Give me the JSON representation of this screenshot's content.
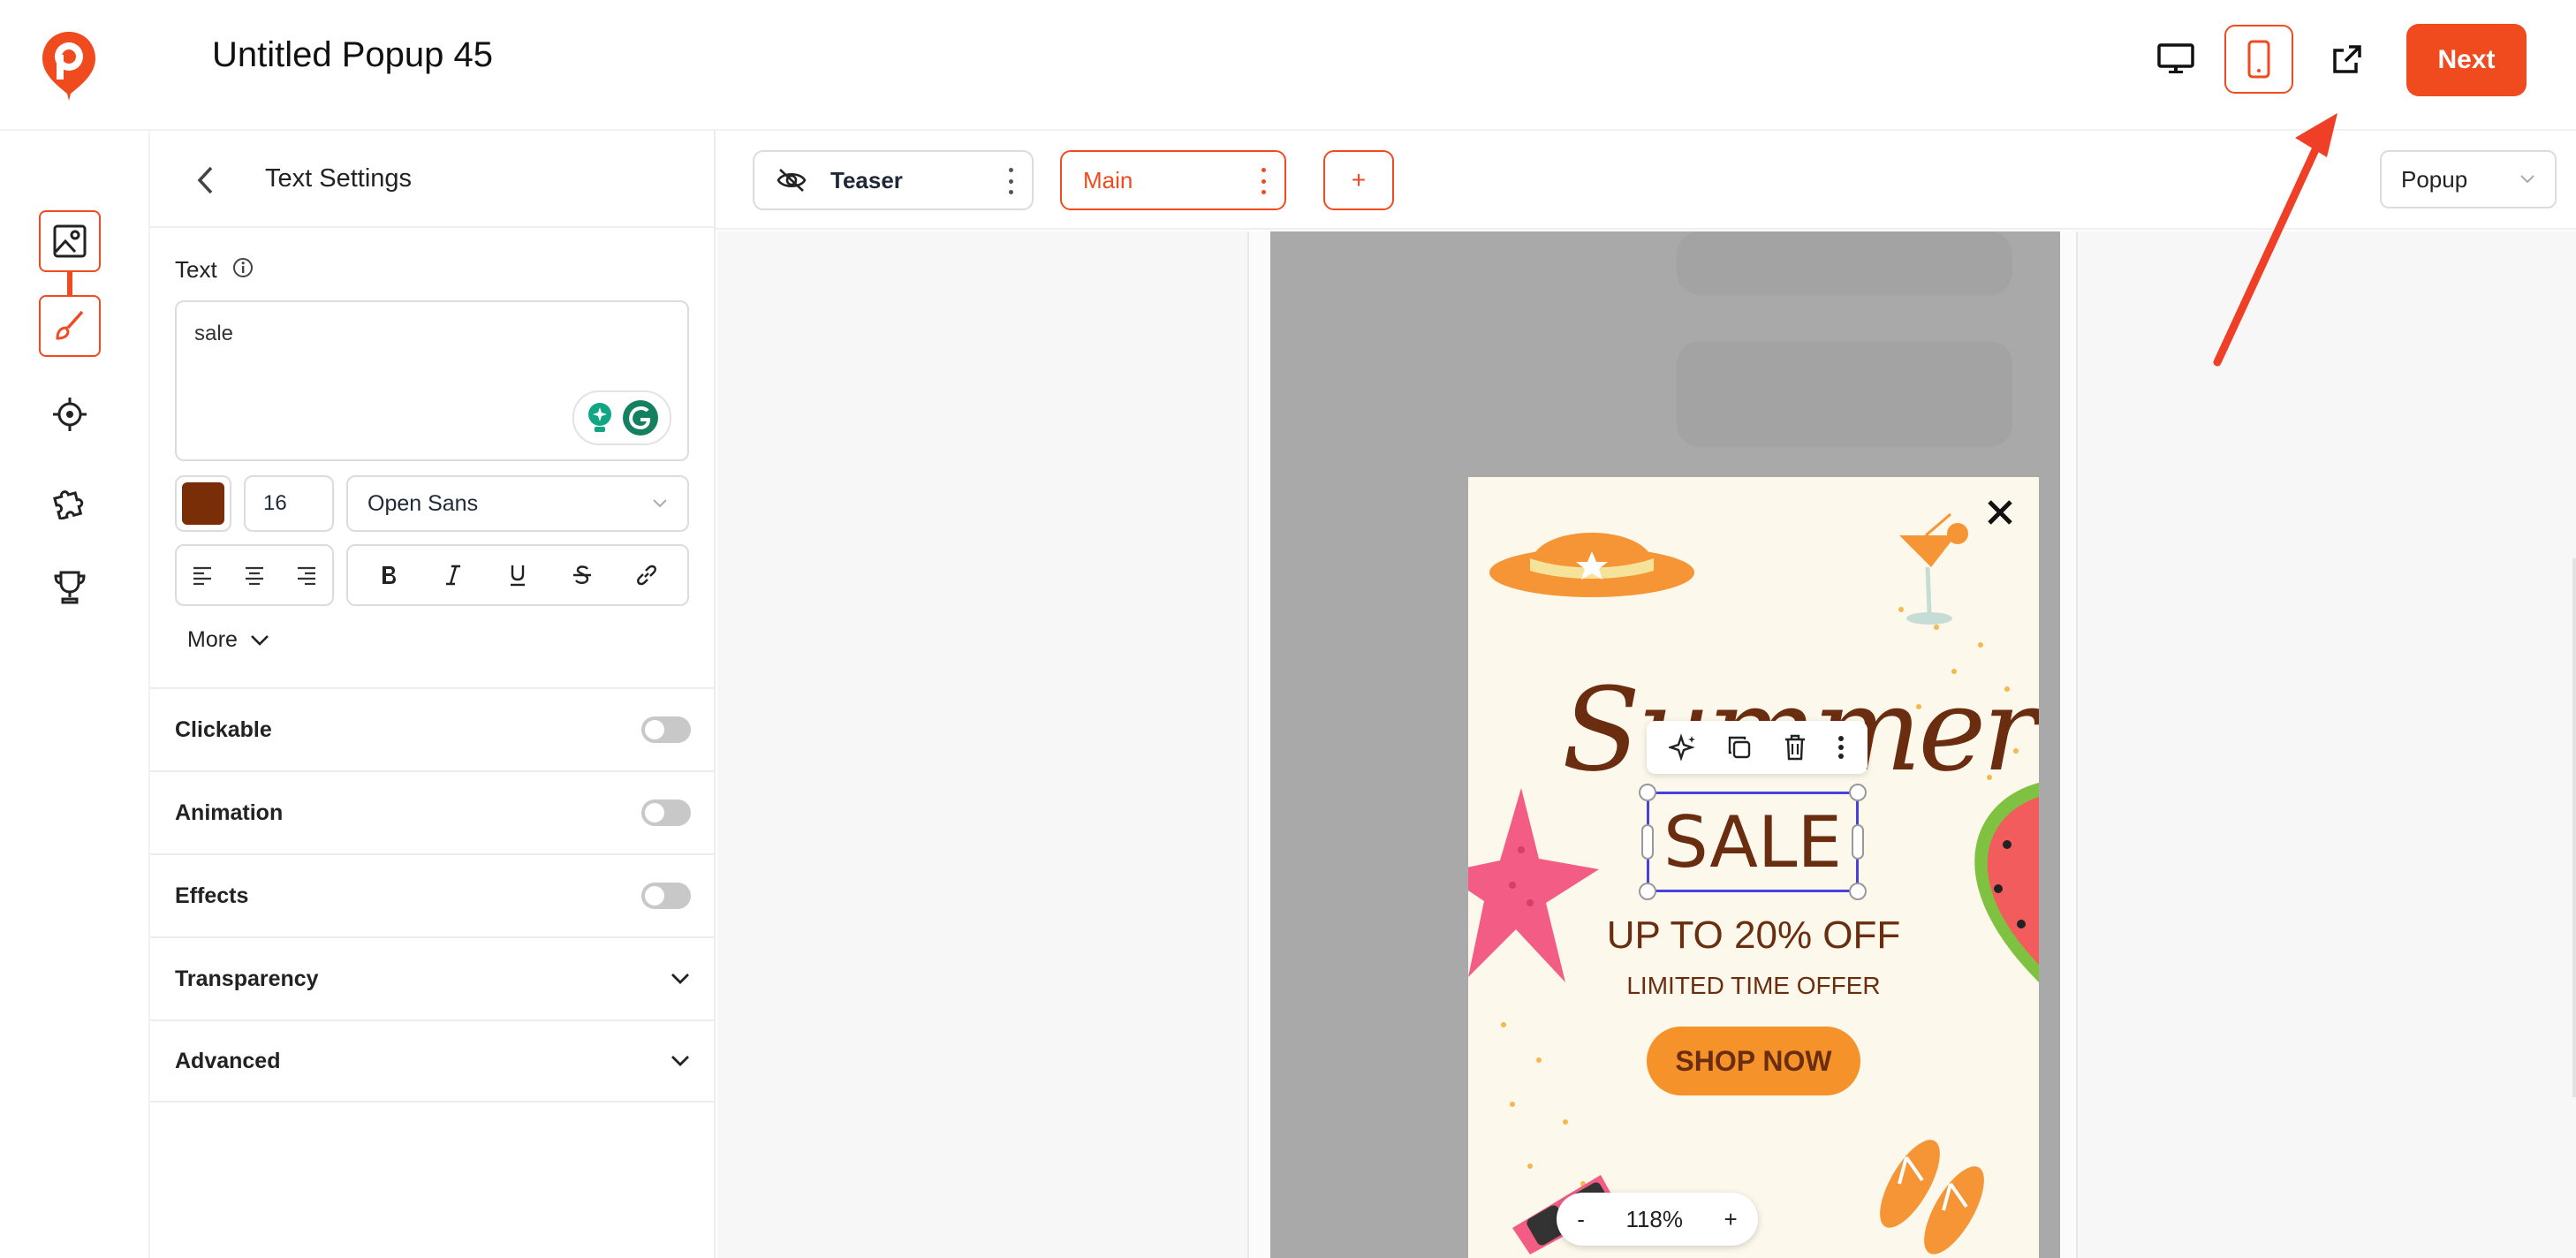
{
  "app": {
    "title": "Untitled Popup 45",
    "next_label": "Next",
    "brand_color": "#f04a1f"
  },
  "header_icons": [
    "desktop-icon",
    "mobile-icon",
    "external-link-icon"
  ],
  "rail": {
    "items": [
      "image-icon",
      "brush-icon",
      "target-icon",
      "puzzle-icon",
      "trophy-icon"
    ],
    "active": "brush-icon"
  },
  "panel": {
    "title": "Text Settings",
    "text_label": "Text",
    "text_value": "sale",
    "color": "#7a2e08",
    "font_size": "16",
    "font_family": "Open Sans",
    "more_label": "More",
    "sections": [
      {
        "label": "Clickable",
        "control": "toggle"
      },
      {
        "label": "Animation",
        "control": "toggle"
      },
      {
        "label": "Effects",
        "control": "toggle"
      },
      {
        "label": "Transparency",
        "control": "chevron"
      },
      {
        "label": "Advanced",
        "control": "chevron"
      }
    ]
  },
  "tabs": {
    "items": [
      {
        "label": "Teaser"
      },
      {
        "label": "Main"
      }
    ],
    "add_label": "+",
    "type_select": "Popup"
  },
  "popup": {
    "script_title": "Summer",
    "sale_text": "SALE",
    "headline": "UP TO 20% OFF",
    "subline": "LIMITED TIME OFFER",
    "cta": "SHOP NOW",
    "close": "✕"
  },
  "zoom": {
    "minus": "-",
    "value": "118%",
    "plus": "+"
  }
}
